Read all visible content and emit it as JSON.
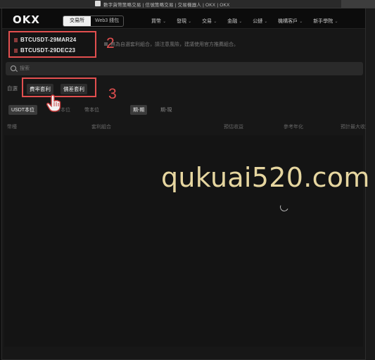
{
  "browser": {
    "tab_title": "數字貨幣策略交易 | 信號策略交易 | 交易機器人 | OKX | OKX"
  },
  "nav": {
    "logo": "OKX",
    "mode_tabs": [
      "交易所",
      "Web3 錢包"
    ],
    "menu": [
      "買幣",
      "發現",
      "交易",
      "金融",
      "公鏈",
      "機構客戶",
      "新手學院"
    ]
  },
  "pairs": {
    "items": [
      "BTCUSDT-29MAR24",
      "BTCUSDT-29DEC23"
    ],
    "hint": "無為自選套利組合，請注意風險，建議使用官方推薦組合。"
  },
  "annotations": {
    "step2": "2",
    "step3": "3"
  },
  "search": {
    "placeholder": "搜索"
  },
  "arbitrage": {
    "prefix": "自選",
    "tabs": [
      "費率套利",
      "價差套利"
    ]
  },
  "filters": {
    "chips": [
      "USDT本位",
      "幣本位",
      "幣本位",
      "期-期",
      "期-現"
    ]
  },
  "table": {
    "headers": [
      "幣種",
      "套利組合",
      "預估收益",
      "參考年化",
      "預計最大收益"
    ]
  },
  "watermark": "qukuai520.com",
  "colors": {
    "highlight": "#e24f4f",
    "watermark": "#e6d6a0"
  }
}
